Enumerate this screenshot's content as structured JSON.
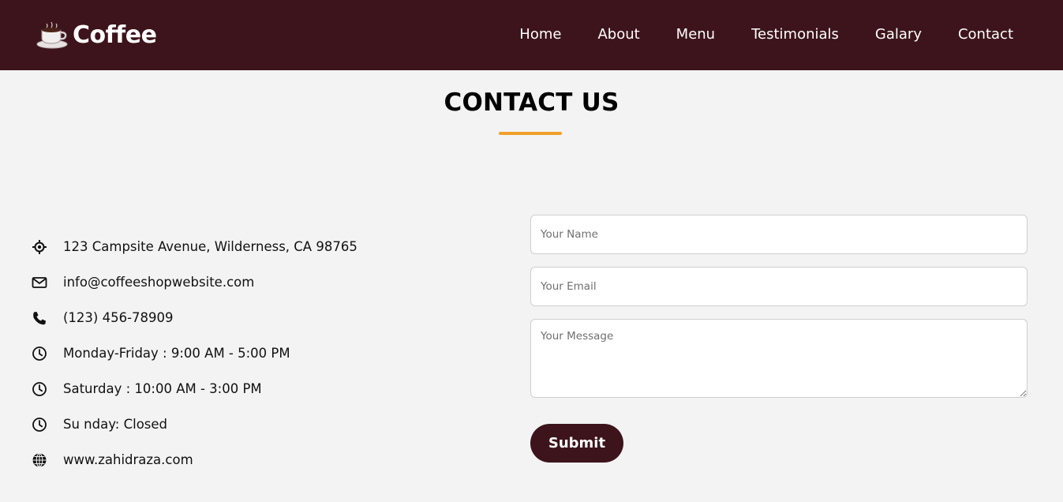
{
  "brand": {
    "name": "Coffee",
    "icon": "coffee-cup-icon"
  },
  "nav": {
    "items": [
      {
        "label": "Home"
      },
      {
        "label": "About"
      },
      {
        "label": "Menu"
      },
      {
        "label": "Testimonials"
      },
      {
        "label": "Galary"
      },
      {
        "label": "Contact"
      }
    ]
  },
  "section": {
    "title": "CONTACT US"
  },
  "colors": {
    "navbar": "#3d141b",
    "accent": "#f0a02a",
    "background": "#f3f3f3"
  },
  "contact_info": [
    {
      "icon": "location-crosshair-icon",
      "text": "123 Campsite Avenue, Wilderness, CA 98765"
    },
    {
      "icon": "envelope-icon",
      "text": "info@coffeeshopwebsite.com"
    },
    {
      "icon": "phone-icon",
      "text": "(123) 456-78909"
    },
    {
      "icon": "clock-icon",
      "text": "Monday-Friday : 9:00 AM - 5:00 PM"
    },
    {
      "icon": "clock-icon",
      "text": "Saturday : 10:00 AM - 3:00 PM"
    },
    {
      "icon": "clock-icon",
      "text": "Su nday: Closed"
    },
    {
      "icon": "globe-icon",
      "text": "www.zahidraza.com"
    }
  ],
  "form": {
    "name_placeholder": "Your Name",
    "email_placeholder": "Your Email",
    "message_placeholder": "Your Message",
    "submit_label": "Submit"
  }
}
